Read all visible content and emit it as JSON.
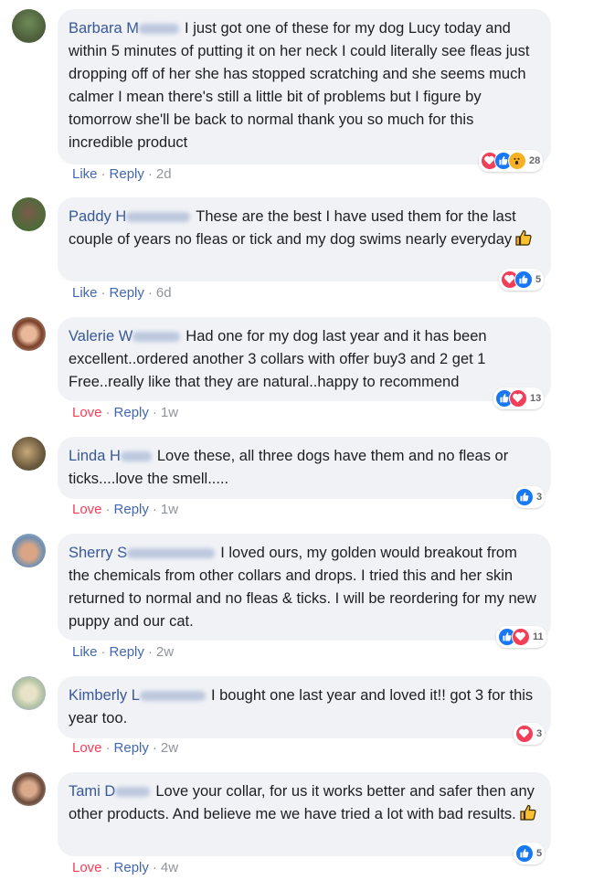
{
  "comments": [
    {
      "author": "Barbara M",
      "text": "I just got one of these for my dog Lucy today and within 5 minutes of putting it on her neck I could literally see fleas just dropping off of her she has stopped scratching and she seems much calmer I mean there's still a little bit of problems but I figure by tomorrow she'll be back to normal thank you so much for this incredible product",
      "reactions": [
        "heart",
        "like",
        "wow"
      ],
      "reaction_count": "28",
      "actions": {
        "primary": "Like",
        "reply": "Reply",
        "time": "2d"
      }
    },
    {
      "author": "Paddy H",
      "text": "These are the best I have used them for the last couple of years no fleas or tick and my dog swims nearly everyday",
      "reactions": [
        "heart",
        "like"
      ],
      "reaction_count": "5",
      "actions": {
        "primary": "Like",
        "reply": "Reply",
        "time": "6d"
      }
    },
    {
      "author": "Valerie W",
      "text": "Had one for my dog last year and it has been excellent..ordered another 3 collars with offer buy3 and 2 get 1 Free..really like that they are natural..happy to recommend",
      "reactions": [
        "like",
        "heart"
      ],
      "reaction_count": "13",
      "actions": {
        "primary": "Love",
        "reply": "Reply",
        "time": "1w"
      }
    },
    {
      "author": "Linda H",
      "text": "Love these, all three dogs have them and no fleas or ticks....love the smell.....",
      "reactions": [
        "like"
      ],
      "reaction_count": "3",
      "actions": {
        "primary": "Love",
        "reply": "Reply",
        "time": "1w"
      }
    },
    {
      "author": "Sherry S",
      "text": "I loved ours, my golden would breakout from the chemicals from other collars and drops. I tried this and her skin returned to normal and no fleas & ticks. I will be reordering for my new puppy and our cat.",
      "reactions": [
        "like",
        "heart"
      ],
      "reaction_count": "11",
      "actions": {
        "primary": "Like",
        "reply": "Reply",
        "time": "2w"
      }
    },
    {
      "author": "Kimberly L",
      "text": "I bought one last year and loved it!! got 3 for this year too.",
      "reactions": [
        "heart"
      ],
      "reaction_count": "3",
      "actions": {
        "primary": "Love",
        "reply": "Reply",
        "time": "2w"
      }
    },
    {
      "author": "Tami D",
      "text": "Love your collar, for us it works better and safer then any other products. And believe me we have tried a lot with bad results.",
      "reactions": [
        "like"
      ],
      "reaction_count": "5",
      "actions": {
        "primary": "Love",
        "reply": "Reply",
        "time": "4w"
      }
    }
  ],
  "colors": {
    "author": "#385898",
    "link": "#4267b2",
    "love": "#f33e58",
    "bubble": "#f0f2f5",
    "meta": "#90949c"
  },
  "icons": {
    "like": "thumbs-up-icon",
    "heart": "heart-icon",
    "wow": "wow-face-icon",
    "thumb_emoji": "thumbs-up-emoji-icon"
  }
}
